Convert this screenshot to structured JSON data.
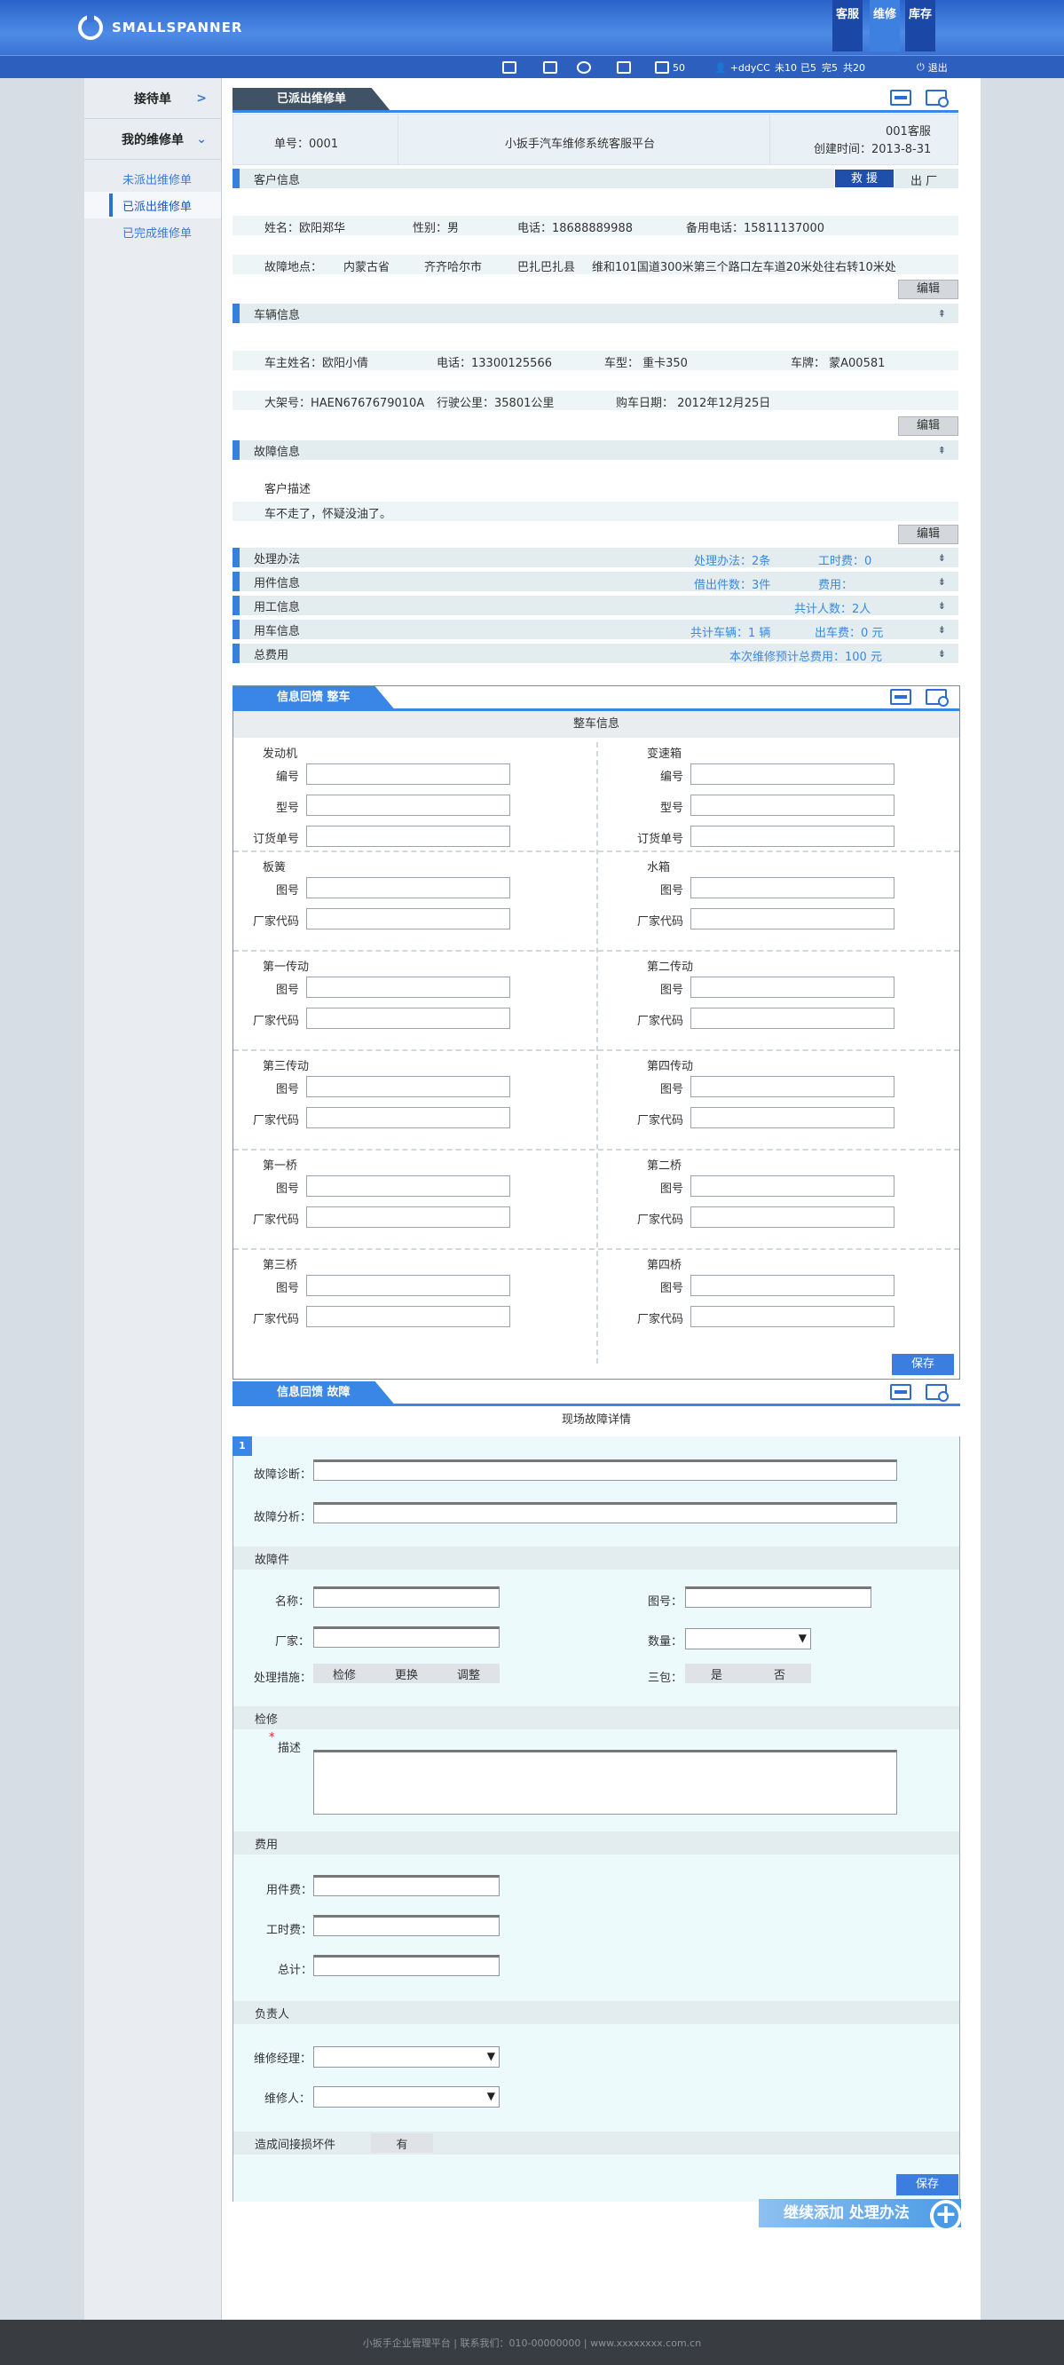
{
  "brand": {
    "name": "SMALLSPANNER"
  },
  "nav_tabs": [
    "客服",
    "维修",
    "库存"
  ],
  "toolbar": {
    "msg_count": "50",
    "user": "+ddyCC",
    "stat1": "未10",
    "stat2": "已5",
    "stat3": "完5",
    "stat4": "共20",
    "logout": "退出"
  },
  "sidebar": {
    "pending_title": "接待单",
    "my_title": "我的维修单",
    "items": [
      "未派出维修单",
      "已派出维修单",
      "已完成维修单"
    ]
  },
  "order": {
    "tab": "已派出维修单",
    "number": "单号：0001",
    "platform": "小扳手汽车维修系统客服平台",
    "owner": "001客服",
    "created": "创建时间：2013-8-31"
  },
  "customer": {
    "title": "客户信息",
    "rescue": "救 援",
    "depart": "出 厂",
    "name": "姓名：欧阳郑华",
    "gender": "性别：男",
    "phone": "电话：18688889988",
    "phone2": "备用电话：15811137000",
    "loc_label": "故障地点：",
    "province": "内蒙古省",
    "city": "齐齐哈尔市",
    "county": "巴扎巴扎县",
    "address": "维和101国道300米第三个路口左车道20米处往右转10米处",
    "edit": "编辑"
  },
  "vehicle": {
    "title": "车辆信息",
    "owner": "车主姓名：欧阳小倩",
    "phone": "电话：13300125566",
    "model": "车型：  重卡350",
    "plate": "车牌：  蒙A00581",
    "vin": "大架号：HAEN6767679010A",
    "mileage": "行驶公里：35801公里",
    "buy_date": "购车日期：  2012年12月25日",
    "edit": "编辑"
  },
  "fault": {
    "title": "故障信息",
    "desc_label": "客户描述",
    "desc": "车不走了，怀疑没油了。",
    "edit": "编辑"
  },
  "summary": [
    {
      "label": "处理办法",
      "info1": "处理办法：2条",
      "info2": "工时费：0"
    },
    {
      "label": "用件信息",
      "info1": "借出件数：3件",
      "info2": "费用："
    },
    {
      "label": "用工信息",
      "info1": "共计人数：2人",
      "info2": ""
    },
    {
      "label": "用车信息",
      "info1": "共计车辆：1 辆",
      "info2": "出车费：0 元"
    },
    {
      "label": "总费用",
      "info1": "本次维修预计总费用：100 元",
      "info2": ""
    }
  ],
  "vehicle_panel": {
    "tab": "信息回馈    整车",
    "header": "整车信息",
    "groups": [
      {
        "left": {
          "title": "发动机",
          "fields": [
            "编号",
            "型号",
            "订货单号"
          ]
        },
        "right": {
          "title": "变速箱",
          "fields": [
            "编号",
            "型号",
            "订货单号"
          ]
        }
      },
      {
        "left": {
          "title": "板簧",
          "fields": [
            "图号",
            "厂家代码"
          ]
        },
        "right": {
          "title": "水箱",
          "fields": [
            "图号",
            "厂家代码"
          ]
        }
      },
      {
        "left": {
          "title": "第一传动",
          "fields": [
            "图号",
            "厂家代码"
          ]
        },
        "right": {
          "title": "第二传动",
          "fields": [
            "图号",
            "厂家代码"
          ]
        }
      },
      {
        "left": {
          "title": "第三传动",
          "fields": [
            "图号",
            "厂家代码"
          ]
        },
        "right": {
          "title": "第四传动",
          "fields": [
            "图号",
            "厂家代码"
          ]
        }
      },
      {
        "left": {
          "title": "第一桥",
          "fields": [
            "图号",
            "厂家代码"
          ]
        },
        "right": {
          "title": "第二桥",
          "fields": [
            "图号",
            "厂家代码"
          ]
        }
      },
      {
        "left": {
          "title": "第三桥",
          "fields": [
            "图号",
            "厂家代码"
          ]
        },
        "right": {
          "title": "第四桥",
          "fields": [
            "图号",
            "厂家代码"
          ]
        }
      }
    ],
    "save": "保存"
  },
  "fault_panel": {
    "tab": "信息回馈    故障",
    "header": "现场故障详情",
    "index": "1",
    "diag_label": "故障诊断：",
    "analysis_label": "故障分析：",
    "parts_title": "故障件",
    "name_label": "名称：",
    "drawing_label": "图号：",
    "maker_label": "厂家：",
    "qty_label": "数量：",
    "measure_label": "处理措施：",
    "measures": [
      "检修",
      "更换",
      "调整"
    ],
    "warranty_label": "三包：",
    "warranty": [
      "是",
      "否"
    ],
    "repair_title": "检修",
    "required_mark": "*",
    "desc_label": "描述",
    "cost_title": "费用",
    "parts_cost": "用件费：",
    "labor_cost": "工时费：",
    "total": "总计：",
    "owner_title": "负责人",
    "manager_label": "维修经理：",
    "repairer_label": "维修人：",
    "indirect_label": "造成间接损坏件",
    "indirect_value": "有",
    "save": "保存"
  },
  "add_more": "继续添加 处理办法",
  "footer": "小扳手企业管理平台  |  联系我们：010-00000000  |  www.xxxxxxxx.com.cn"
}
